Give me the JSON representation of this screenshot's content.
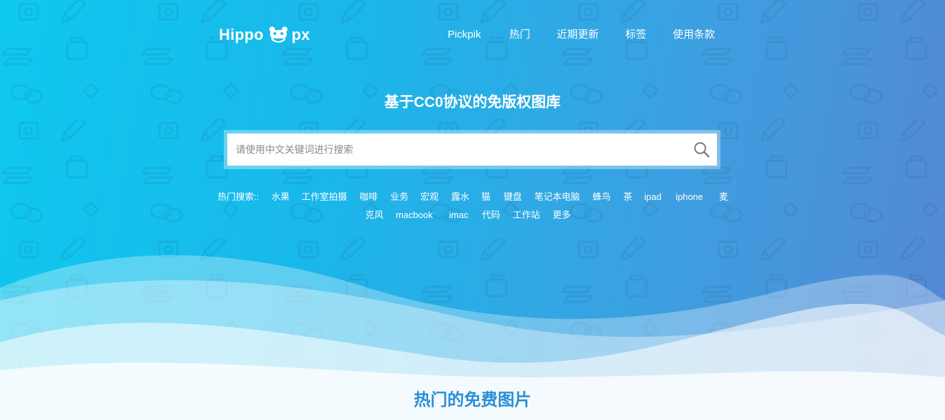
{
  "brand": {
    "left_text": "Hippo",
    "right_text": "px",
    "mascot_icon": "hippo-face-icon"
  },
  "nav": {
    "items": [
      {
        "label": "Pickpik"
      },
      {
        "label": "热门"
      },
      {
        "label": "近期更新"
      },
      {
        "label": "标签"
      },
      {
        "label": "使用条款"
      }
    ]
  },
  "hero": {
    "headline": "基于CC0协议的免版权图库"
  },
  "search": {
    "placeholder": "请使用中文关键词进行搜索",
    "value": "",
    "icon": "search-icon"
  },
  "hot_searches": {
    "label": "热门搜索::",
    "tags": [
      "水果",
      "工作室拍摄",
      "咖啡",
      "业务",
      "宏观",
      "露水",
      "猫",
      "键盘",
      "笔记本电脑",
      "蜂鸟",
      "茶",
      "ipad",
      "iphone",
      "麦克风",
      "macbook",
      "imac",
      "代码",
      "工作站",
      "更多"
    ]
  },
  "section": {
    "title": "热门的免费图片"
  },
  "colors": {
    "gradient_start": "#0fc9ee",
    "gradient_end": "#5587d4",
    "section_title": "#2a8fd6"
  }
}
